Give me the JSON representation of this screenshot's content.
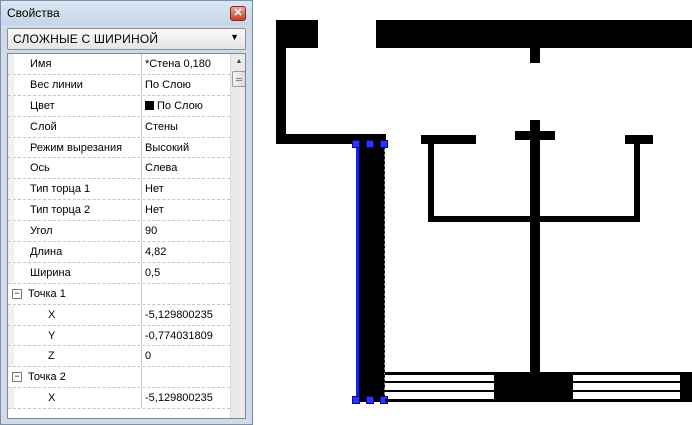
{
  "window": {
    "title": "Свойства",
    "close_glyph": "✕"
  },
  "combo": {
    "selected": "СЛОЖНЫЕ С ШИРИНОЙ",
    "arrow_glyph": "▼"
  },
  "properties": [
    {
      "name": "Имя",
      "value": "*Стена 0,180"
    },
    {
      "name": "Вес линии",
      "value": "По Слою"
    },
    {
      "name": "Цвет",
      "value": "По Слою",
      "swatch": "#000000"
    },
    {
      "name": "Слой",
      "value": "Стены"
    },
    {
      "name": "Режим вырезания",
      "value": "Высокий"
    },
    {
      "name": "Ось",
      "value": "Слева"
    },
    {
      "name": "Тип торца 1",
      "value": "Нет"
    },
    {
      "name": "Тип торца 2",
      "value": "Нет"
    },
    {
      "name": "Угол",
      "value": "90"
    },
    {
      "name": "Длина",
      "value": "4,82"
    },
    {
      "name": "Ширина",
      "value": "0,5"
    }
  ],
  "point1": {
    "label": "Точка 1",
    "expander": "−",
    "x_label": "X",
    "x_value": "-5,129800235",
    "y_label": "Y",
    "y_value": "-0,774031809",
    "z_label": "Z",
    "z_value": "0"
  },
  "point2": {
    "label": "Точка 2",
    "expander": "−",
    "x_label": "X",
    "x_value": "-5,129800235"
  },
  "scrollbar": {
    "up_glyph": "▲"
  },
  "colors": {
    "panel_bg": "#cfdbe9",
    "selection_blue": "#1a24d6",
    "wall_fill": "#000000"
  }
}
